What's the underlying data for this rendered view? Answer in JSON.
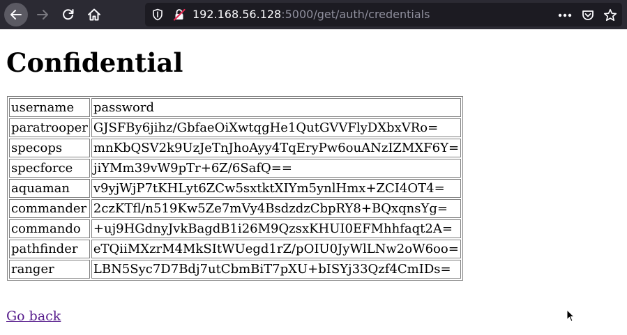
{
  "browser": {
    "url_host": "192.168.56.128",
    "url_path": ":5000/get/auth/credentials"
  },
  "page": {
    "title": "Confidential",
    "table": {
      "headers": [
        "username",
        "password"
      ],
      "rows": [
        [
          "paratrooper",
          "GJSFBy6jihz/GbfaeOiXwtqgHe1QutGVVFlyDXbxVRo="
        ],
        [
          "specops",
          "mnKbQSV2k9UzJeTnJhoAyy4TqEryPw6ouANzIZMXF6Y="
        ],
        [
          "specforce",
          "jiYMm39vW9pTr+6Z/6SafQ=="
        ],
        [
          "aquaman",
          "v9yjWjP7tKHLyt6ZCw5sxtktXIYm5ynlHmx+ZCI4OT4="
        ],
        [
          "commander",
          "2czKTfl/n519Kw5Ze7mVy4BsdzdzCbpRY8+BQxqnsYg="
        ],
        [
          "commando",
          "+uj9HGdnyJvkBagdB1i26M9QzsxKHUI0EFMhhfaqt2A="
        ],
        [
          "pathfinder",
          "eTQiiMXzrM4MkSItWUegd1rZ/pOIU0JyWlLNw2oW6oo="
        ],
        [
          "ranger",
          "LBN5Syc7D7Bdj7utCbmBiT7pXU+bISYj33Qzf4CmIDs="
        ]
      ]
    },
    "back_link": "Go back"
  },
  "colors": {
    "toolbar_bg": "#2b2a33",
    "urlbar_bg": "#1c1b22",
    "visited_link": "#551a8b"
  }
}
